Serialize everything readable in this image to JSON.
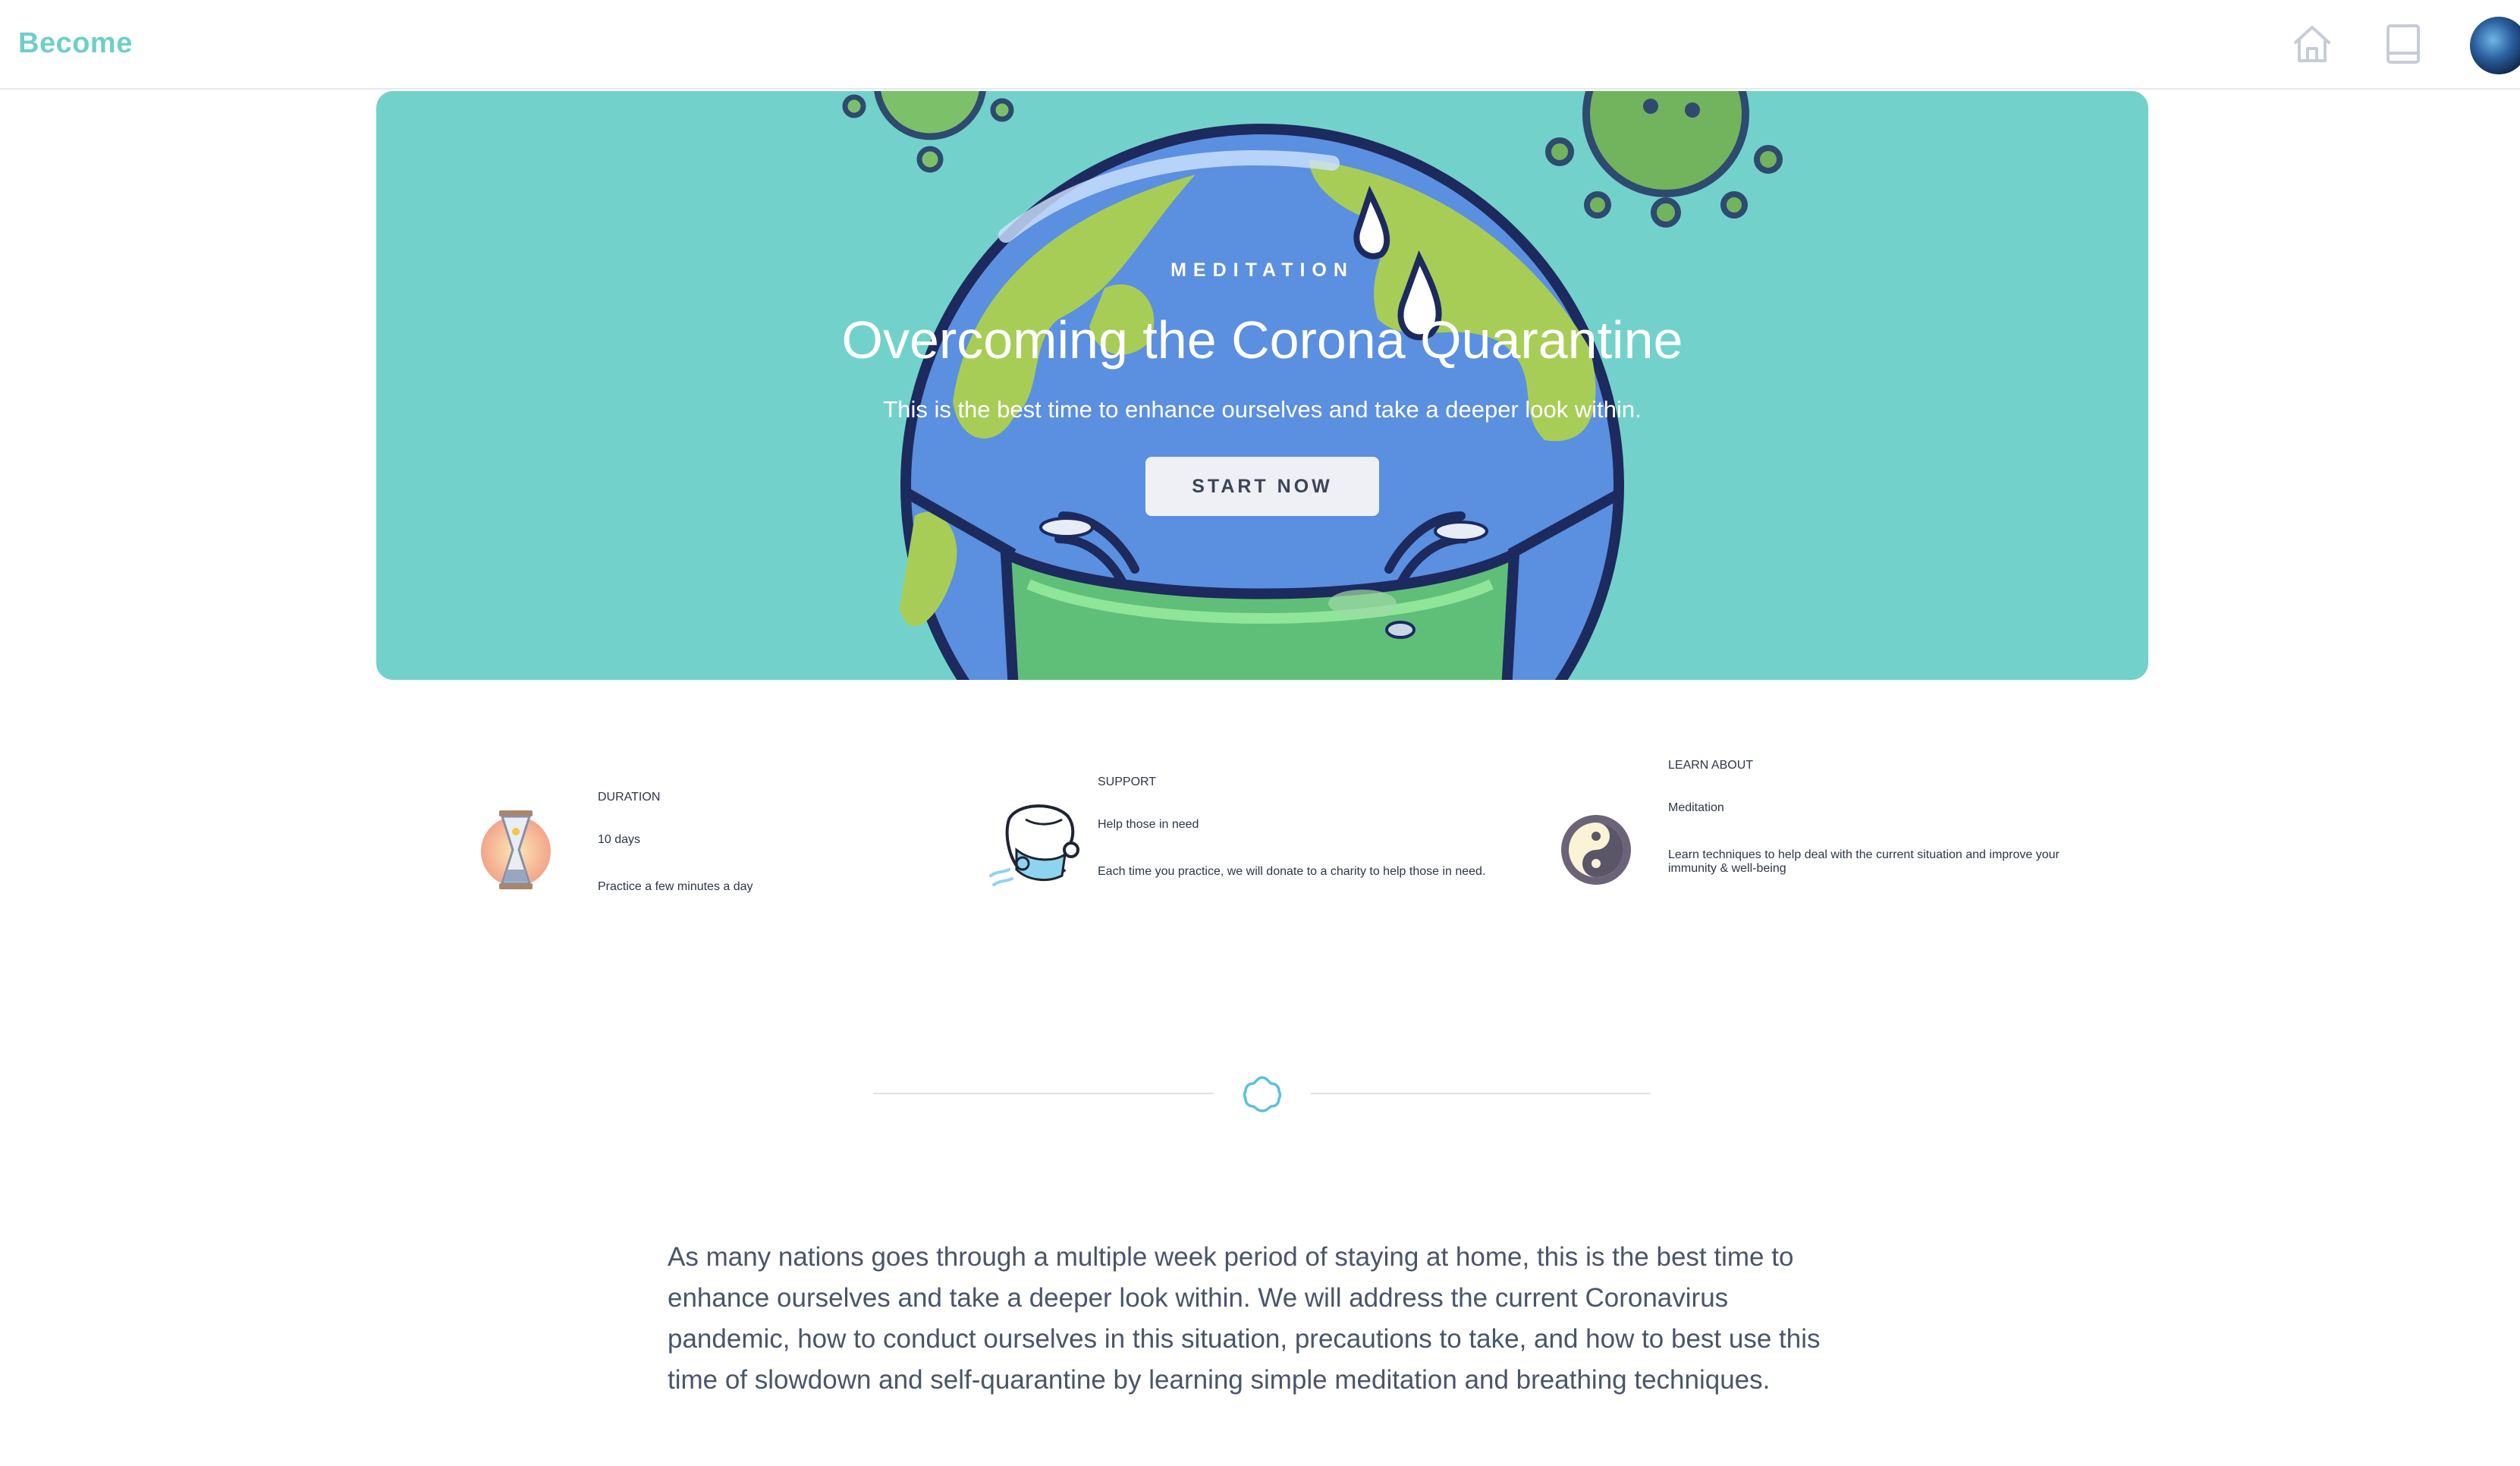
{
  "brand": {
    "name": "Become",
    "color": "#6fcfc6"
  },
  "nav": {
    "icons": [
      "home-icon",
      "book-icon",
      "avatar"
    ]
  },
  "hero": {
    "eyebrow": "MEDITATION",
    "title": "Overcoming the Corona Quarantine",
    "subtitle": "This is the best time to enhance ourselves and take a deeper look within.",
    "cta_label": "START NOW",
    "background": "#72d2cb"
  },
  "features": [
    {
      "icon": "hourglass-icon",
      "eyebrow": "DURATION",
      "title": "10 days",
      "description": "Practice a few minutes a day"
    },
    {
      "icon": "masked-person-icon",
      "eyebrow": "SUPPORT",
      "title": "Help those in need",
      "description": "Each time you practice, we will donate to a charity to help those in need."
    },
    {
      "icon": "yin-yang-icon",
      "eyebrow": "LEARN ABOUT",
      "title": "Meditation",
      "description": "Learn techniques to help deal with the current situation and improve your immunity & well-being"
    }
  ],
  "divider": {
    "icon": "flower-outline-icon",
    "color": "#5bbfdf"
  },
  "body": {
    "text": "As many nations goes through a multiple week period of staying at home, this is the best time to enhance ourselves and take a deeper look within.  We will address the current Coronavirus pandemic, how to conduct ourselves in this situation, precautions to take, and how to best use this time of slowdown and self-quarantine by learning simple meditation and breathing techniques."
  }
}
